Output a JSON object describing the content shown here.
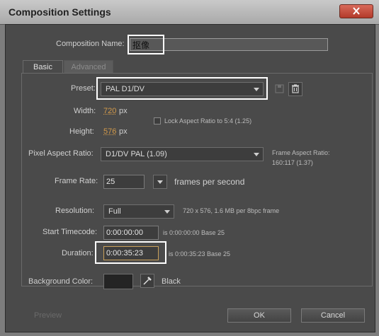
{
  "window": {
    "title": "Composition Settings"
  },
  "composition_name": {
    "label": "Composition Name:",
    "value": "抠像"
  },
  "tabs": [
    {
      "label": "Basic"
    },
    {
      "label": "Advanced"
    }
  ],
  "preset": {
    "label": "Preset:",
    "value": "PAL D1/DV"
  },
  "width": {
    "label": "Width:",
    "value": "720",
    "unit": "px"
  },
  "height": {
    "label": "Height:",
    "value": "576",
    "unit": "px"
  },
  "lock_aspect": {
    "label": "Lock Aspect Ratio to 5:4 (1.25)"
  },
  "pixel_aspect": {
    "label": "Pixel Aspect Ratio:",
    "value": "D1/DV PAL (1.09)",
    "frame_aspect_label": "Frame Aspect Ratio:",
    "frame_aspect_value": "160:117 (1.37)"
  },
  "frame_rate": {
    "label": "Frame Rate:",
    "value": "25",
    "unit": "frames per second"
  },
  "resolution": {
    "label": "Resolution:",
    "value": "Full",
    "info": "720 x 576, 1.6 MB per 8bpc frame"
  },
  "start_timecode": {
    "label": "Start Timecode:",
    "value": "0:00:00:00",
    "info": "is 0:00:00:00  Base 25"
  },
  "duration": {
    "label": "Duration:",
    "value": "0:00:35:23",
    "info": "is 0:00:35:23  Base 25"
  },
  "background": {
    "label": "Background Color:",
    "color_name": "Black",
    "swatch_color": "#242424"
  },
  "footer": {
    "preview_label": "Preview",
    "ok_label": "OK",
    "cancel_label": "Cancel"
  }
}
